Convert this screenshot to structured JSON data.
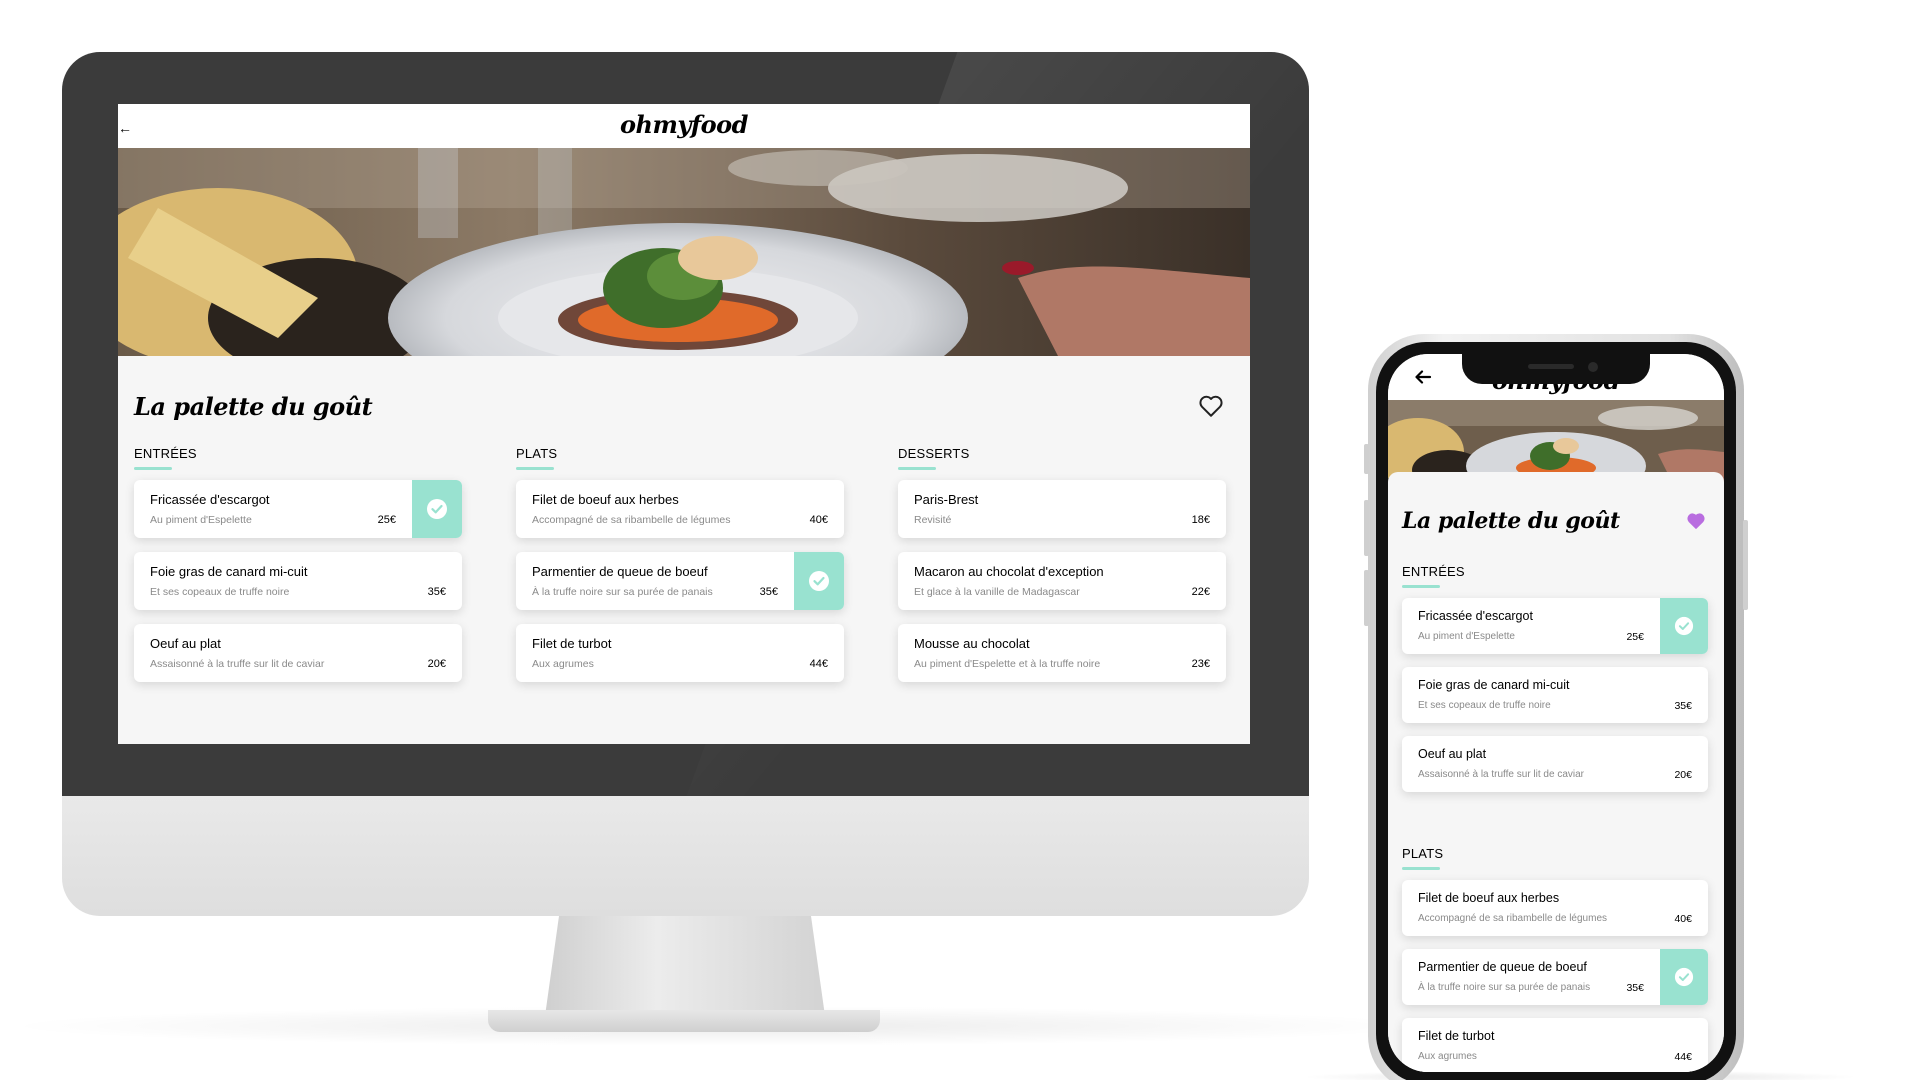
{
  "app": {
    "logo": "ohmyfood",
    "back_arrow_desktop": "←",
    "restaurant_title": "La palette du goût"
  },
  "colors": {
    "accent_mint": "#99e2d0",
    "heart_purple": "#b96de0",
    "monitor_bezel": "#3b3b3b",
    "page_background": "#f6f6f6"
  },
  "icons": {
    "favorite_desktop": "heart-outline-icon",
    "favorite_mobile": "heart-filled-icon",
    "selected": "check-circle-icon",
    "back": "arrow-left-icon"
  },
  "menu": {
    "entrees": {
      "heading": "ENTRÉES",
      "items": [
        {
          "name": "Fricassée d'escargot",
          "desc": "Au piment d'Espelette",
          "price": "25€",
          "selected": true
        },
        {
          "name": "Foie gras de canard mi-cuit",
          "desc": "Et ses copeaux de truffe noire",
          "price": "35€",
          "selected": false
        },
        {
          "name": "Oeuf au plat",
          "desc": "Assaisonné à la truffe sur lit de caviar",
          "price": "20€",
          "selected": false
        }
      ]
    },
    "plats": {
      "heading": "PLATS",
      "items": [
        {
          "name": "Filet de boeuf aux herbes",
          "desc": "Accompagné de sa ribambelle de légumes",
          "price": "40€",
          "selected": false
        },
        {
          "name": "Parmentier de queue de boeuf",
          "desc": "À la truffe noire sur sa purée de panais",
          "price": "35€",
          "selected": true
        },
        {
          "name": "Filet de turbot",
          "desc": "Aux agrumes",
          "price": "44€",
          "selected": false
        }
      ]
    },
    "desserts": {
      "heading": "DESSERTS",
      "items": [
        {
          "name": "Paris-Brest",
          "desc": "Revisité",
          "price": "18€",
          "selected": false
        },
        {
          "name": "Macaron au chocolat d'exception",
          "desc": "Et glace à la vanille de Madagascar",
          "price": "22€",
          "selected": false
        },
        {
          "name": "Mousse au chocolat",
          "desc": "Au piment d'Espelette et à la truffe noire",
          "price": "23€",
          "selected": false
        }
      ]
    }
  }
}
